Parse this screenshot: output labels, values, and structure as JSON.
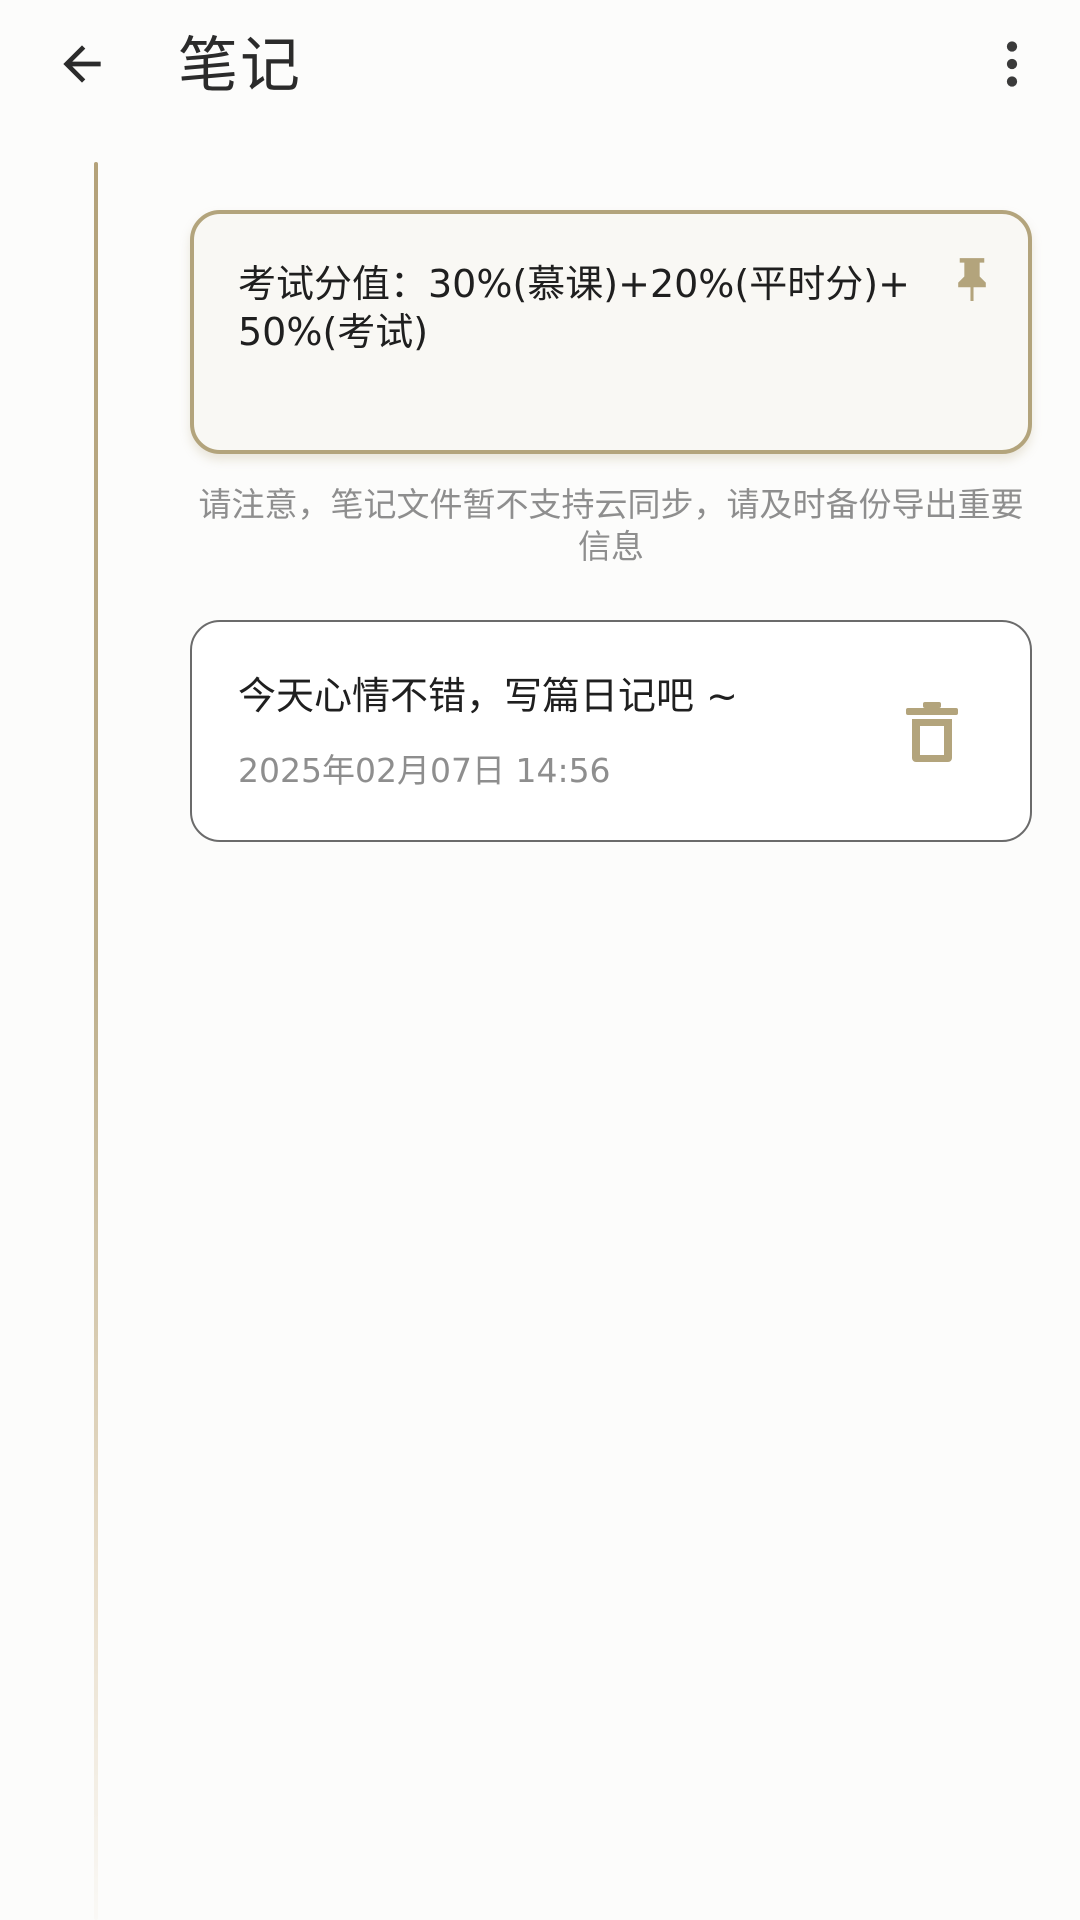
{
  "header": {
    "title": "笔记",
    "back_icon": "arrow-left-icon",
    "more_icon": "more-vertical-icon"
  },
  "pinned_note": {
    "text": "考试分值：30%(慕课)+20%(平时分)+50%(考试)",
    "icon": "pin-icon"
  },
  "notice": {
    "text": "请注意，笔记文件暂不支持云同步，请及时备份导出重要信息"
  },
  "notes": [
    {
      "title": "今天心情不错，写篇日记吧 ~",
      "time": "2025年02月07日 14:56",
      "delete_icon": "trash-icon"
    }
  ],
  "colors": {
    "accent": "#b3a47c",
    "background": "#fcfcfb",
    "text_primary": "#1f1f1f",
    "text_secondary": "#8e8e8e",
    "card_border": "#6b6b6b"
  }
}
